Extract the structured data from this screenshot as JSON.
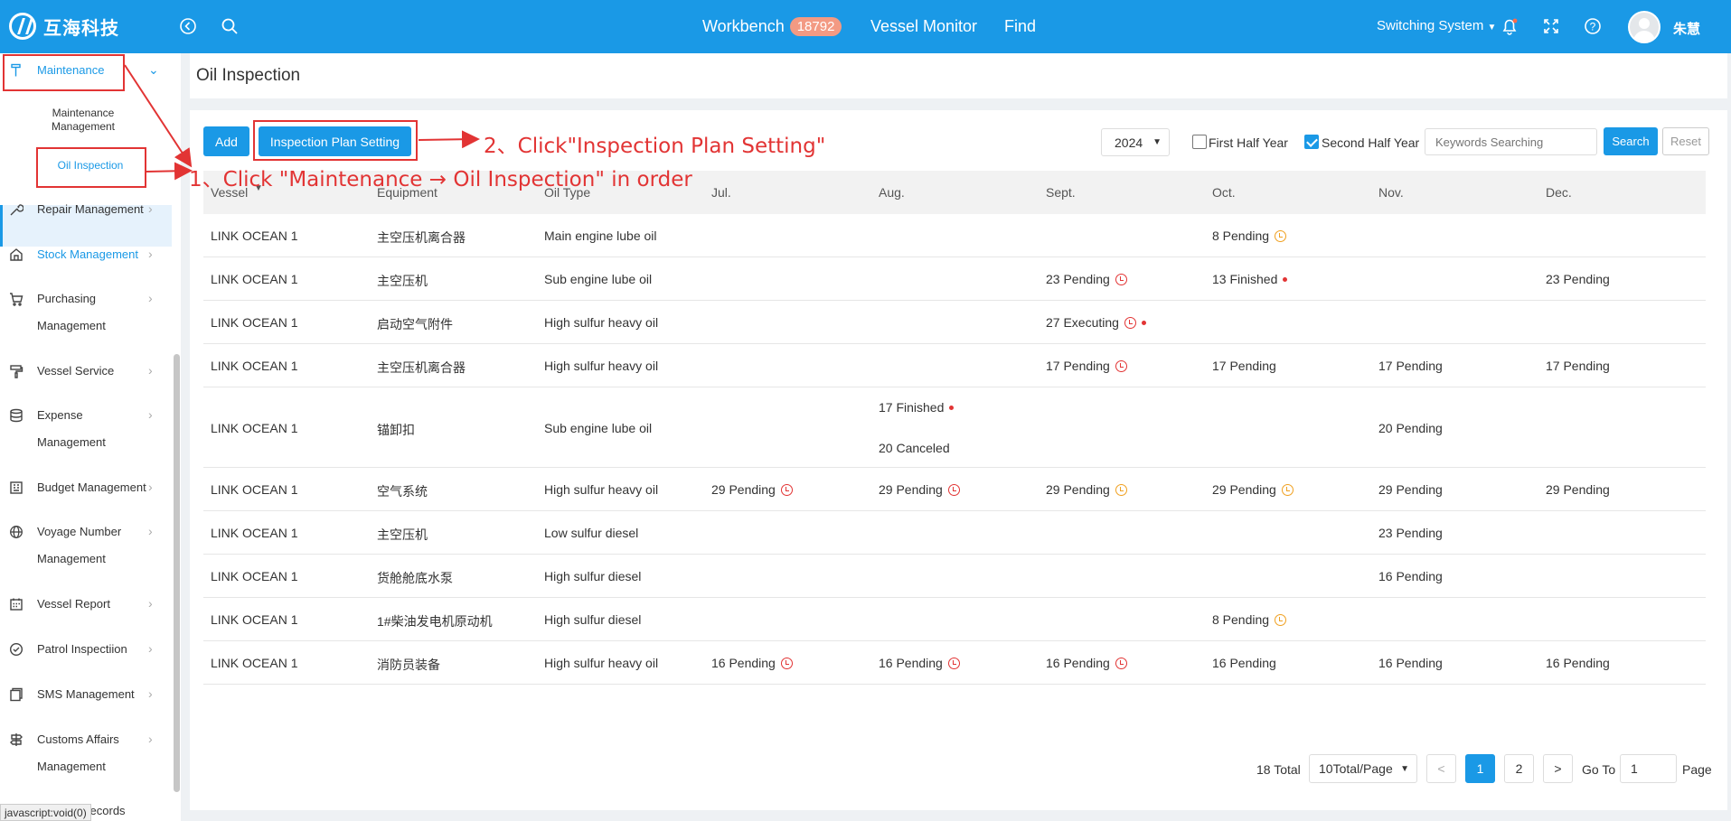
{
  "app": {
    "name": "互海科技"
  },
  "topnav": {
    "workbench": "Workbench",
    "workbench_badge": "18792",
    "vessel_monitor": "Vessel Monitor",
    "find": "Find",
    "switching": "Switching System",
    "username": "朱慧"
  },
  "sidebar": {
    "maintenance": "Maintenance",
    "maintenance_mgmt_1": "Maintenance",
    "maintenance_mgmt_2": "Management",
    "oil_inspection": "Oil Inspection",
    "repair": "Repair Management",
    "stock": "Stock Management",
    "purchasing_1": "Purchasing",
    "purchasing_2": "Management",
    "vessel_service": "Vessel Service",
    "expense_1": "Expense",
    "expense_2": "Management",
    "budget": "Budget Management",
    "voyage_1": "Voyage Number",
    "voyage_2": "Management",
    "vessel_report": "Vessel Report",
    "patrol": "Patrol Inspectiion",
    "sms": "SMS Management",
    "customs_1": "Customs Affairs",
    "customs_2": "Management",
    "incident": "Incident Records"
  },
  "page": {
    "title": "Oil Inspection"
  },
  "toolbar": {
    "add": "Add",
    "plan_setting": "Inspection Plan Setting",
    "year": "2024",
    "first_half": "First Half Year",
    "second_half": "Second Half Year",
    "first_half_checked": false,
    "second_half_checked": true,
    "search_placeholder": "Keywords Searching",
    "search": "Search",
    "reset": "Reset"
  },
  "table": {
    "headers": [
      "Vessel",
      "Equipment",
      "Oil Type",
      "Jul.",
      "Aug.",
      "Sept.",
      "Oct.",
      "Nov.",
      "Dec."
    ],
    "rows": [
      {
        "vessel": "LINK OCEAN 1",
        "equipment": "主空压机离合器",
        "oil": "Main engine lube oil",
        "jul": "",
        "aug": "",
        "sep": "",
        "oct": "8 Pending",
        "nov": "",
        "dec": ""
      },
      {
        "vessel": "LINK OCEAN 1",
        "equipment": "主空压机",
        "oil": "Sub engine lube oil",
        "jul": "",
        "aug": "",
        "sep": "23 Pending",
        "oct": "13 Finished",
        "nov": "",
        "dec": "23 Pending"
      },
      {
        "vessel": "LINK OCEAN 1",
        "equipment": "启动空气附件",
        "oil": "High sulfur heavy oil",
        "jul": "",
        "aug": "",
        "sep": "27 Executing",
        "oct": "",
        "nov": "",
        "dec": ""
      },
      {
        "vessel": "LINK OCEAN 1",
        "equipment": "主空压机离合器",
        "oil": "High sulfur heavy oil",
        "jul": "",
        "aug": "",
        "sep": "17 Pending",
        "oct": "17 Pending",
        "nov": "17 Pending",
        "dec": "17 Pending"
      },
      {
        "vessel": "LINK OCEAN 1",
        "equipment": "锚卸扣",
        "oil": "Sub engine lube oil",
        "jul": "",
        "aug": "17 Finished",
        "aug2": "20 Canceled",
        "sep": "",
        "oct": "",
        "nov": "20 Pending",
        "dec": ""
      },
      {
        "vessel": "LINK OCEAN 1",
        "equipment": "空气系统",
        "oil": "High sulfur heavy oil",
        "jul": "29 Pending",
        "aug": "29 Pending",
        "sep": "29 Pending",
        "oct": "29 Pending",
        "nov": "29 Pending",
        "dec": "29 Pending"
      },
      {
        "vessel": "LINK OCEAN 1",
        "equipment": "主空压机",
        "oil": "Low sulfur diesel",
        "jul": "",
        "aug": "",
        "sep": "",
        "oct": "",
        "nov": "23 Pending",
        "dec": ""
      },
      {
        "vessel": "LINK OCEAN 1",
        "equipment": "货舱舱底水泵",
        "oil": "High sulfur diesel",
        "jul": "",
        "aug": "",
        "sep": "",
        "oct": "",
        "nov": "16 Pending",
        "dec": ""
      },
      {
        "vessel": "LINK OCEAN 1",
        "equipment": "1#柴油发电机原动机",
        "oil": "High sulfur diesel",
        "jul": "",
        "aug": "",
        "sep": "",
        "oct": "8 Pending",
        "nov": "",
        "dec": ""
      },
      {
        "vessel": "LINK OCEAN 1",
        "equipment": "消防员装备",
        "oil": "High sulfur heavy oil",
        "jul": "16 Pending",
        "aug": "16 Pending",
        "sep": "16 Pending",
        "oct": "16 Pending",
        "nov": "16 Pending",
        "dec": "16 Pending"
      }
    ]
  },
  "pager": {
    "total": "18 Total",
    "per_page": "10Total/Page",
    "prev": "<",
    "p1": "1",
    "p2": "2",
    "next": ">",
    "goto": "Go To",
    "goto_value": "1",
    "page": "Page"
  },
  "annotations": {
    "step1": "1、Click \"Maintenance → Oil Inspection\" in order",
    "step2": "2、Click\"Inspection Plan Setting\""
  },
  "status_tip": "javascript:void(0)",
  "colors": {
    "primary": "#1a99e6",
    "annotation": "#e23434",
    "pending_warn": "#f0a020"
  }
}
